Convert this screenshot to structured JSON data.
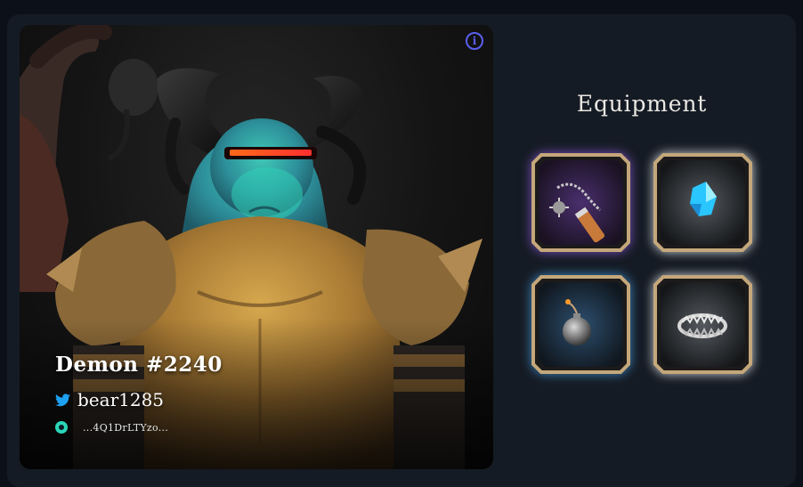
{
  "character": {
    "name": "Demon #2240",
    "twitter_handle": "bear1285",
    "wallet_address": "...4Q1DrLTYzo..."
  },
  "equipment": {
    "title": "Equipment",
    "slots": [
      {
        "item_icon": "flail-icon",
        "rarity_color": "#7a4fc0"
      },
      {
        "item_icon": "crystal-shard-icon",
        "rarity_color": "#cfd3d8"
      },
      {
        "item_icon": "bomb-icon",
        "rarity_color": "#3f88c4"
      },
      {
        "item_icon": "bear-trap-icon",
        "rarity_color": "#cfd3d8"
      }
    ]
  },
  "icons": {
    "info": "info-icon",
    "twitter": "twitter-icon",
    "wallet": "wallet-icon"
  },
  "colors": {
    "page_background": "#0c1119",
    "card_background": "#151b24",
    "accent_blue": "#5a5ff0",
    "twitter_blue": "#1da1f2",
    "wallet_teal": "#2ad6b8",
    "slot_frame_gold": "#c4a77a"
  }
}
